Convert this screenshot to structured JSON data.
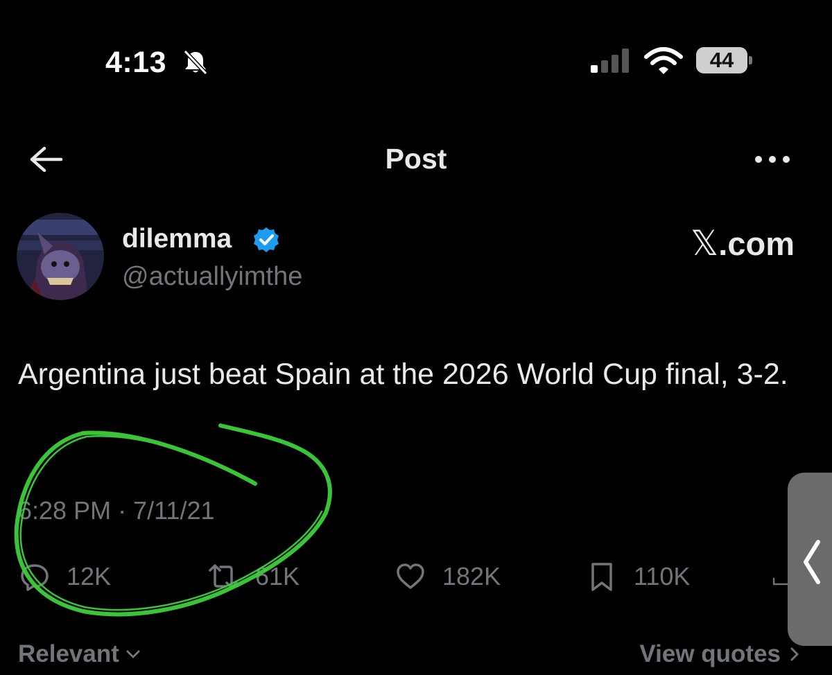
{
  "status_bar": {
    "time": "4:13",
    "battery": "44",
    "icons": [
      "bell-slash-icon",
      "cellular-signal-icon",
      "wifi-icon",
      "battery-icon"
    ]
  },
  "header": {
    "title": "Post",
    "back_icon": "arrow-left-icon",
    "more_icon": "ellipsis-icon"
  },
  "author": {
    "name": "dilemma",
    "handle": "@actuallyimthe",
    "verified": true,
    "site_symbol": "𝕏",
    "site_suffix": ".com"
  },
  "tweet": {
    "text": "Argentina just beat Spain at the 2026 World Cup final, 3-2.",
    "timestamp": "6:28 PM · 7/11/21"
  },
  "actions": {
    "replies": "12K",
    "reposts": "61K",
    "likes": "182K",
    "bookmarks": "110K"
  },
  "footer": {
    "sort_label": "Relevant",
    "quotes_label": "View quotes"
  },
  "colors": {
    "background": "#000000",
    "text": "#e7e9ea",
    "muted": "#71767b",
    "verified": "#1d9bf0",
    "annotation": "#3ecf3a"
  }
}
